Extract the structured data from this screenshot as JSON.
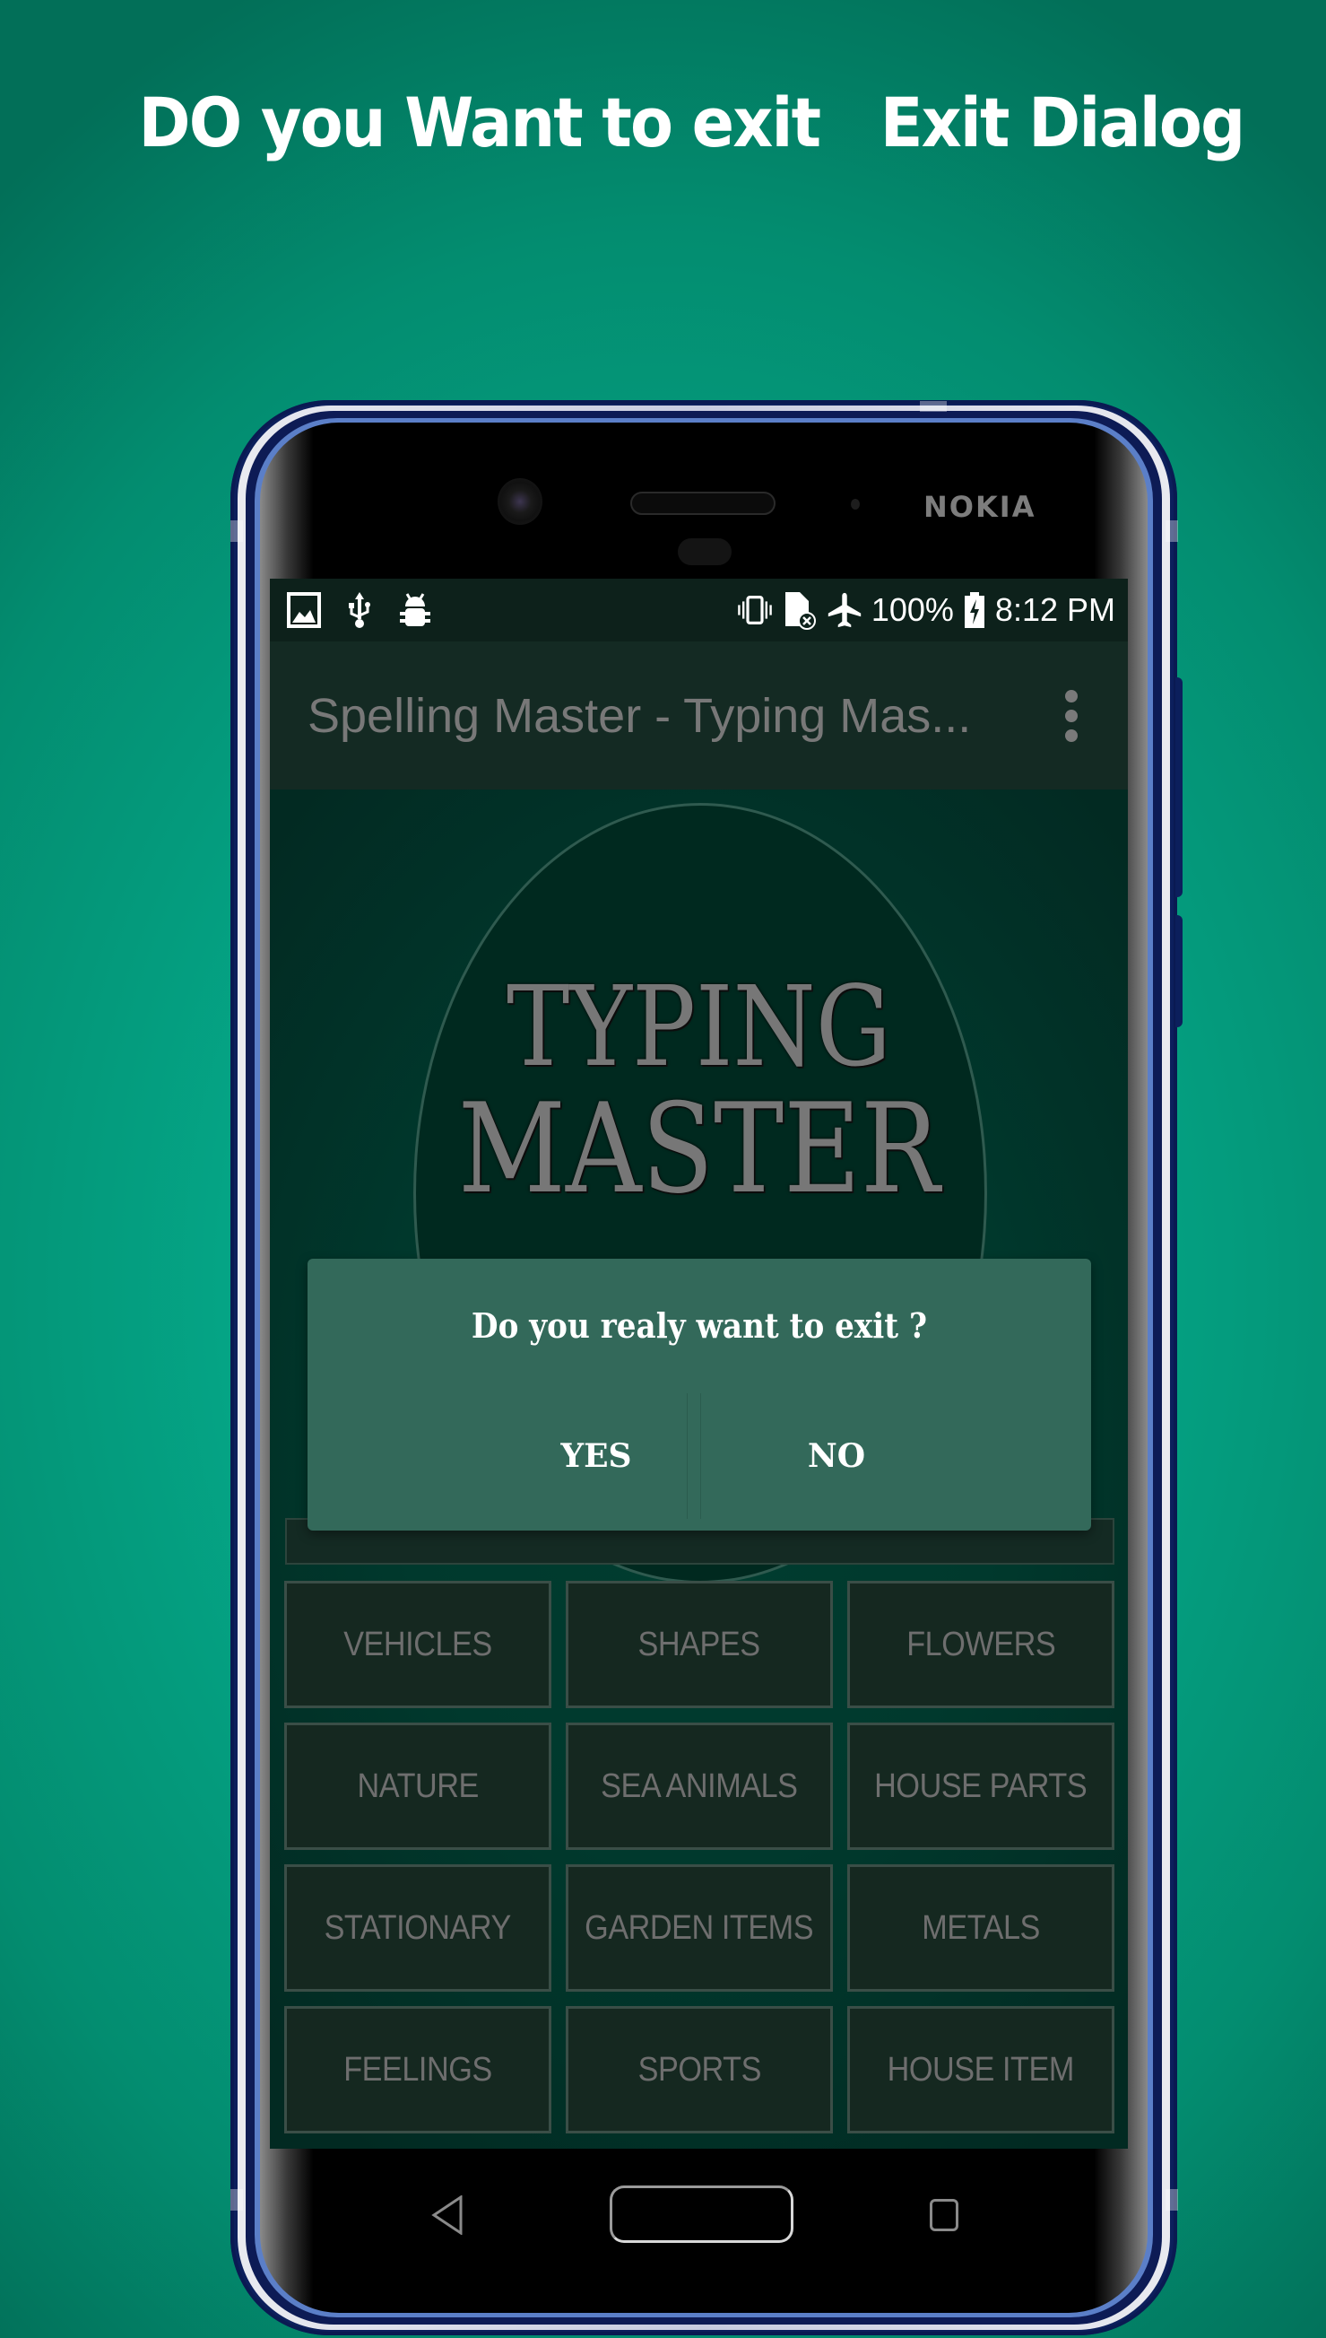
{
  "promo": {
    "title": "DO you Want to exit   Exit Dialog"
  },
  "device": {
    "brand": "NOKIA"
  },
  "status_bar": {
    "left_icons": [
      "image-icon",
      "usb-icon",
      "android-debug-icon"
    ],
    "right_icons": [
      "vibrate-icon",
      "no-sim-icon",
      "airplane-icon"
    ],
    "battery": "100%",
    "battery_icon": "battery-charging-icon",
    "time": "8:12 PM"
  },
  "app_bar": {
    "title": "Spelling Master - Typing Mas...",
    "menu_icon": "overflow-menu-icon"
  },
  "logo": {
    "line1": "TYPING",
    "line2": "MASTER"
  },
  "dialog": {
    "message": "Do you realy want to exit ?",
    "yes_label": "YES",
    "no_label": "NO"
  },
  "categories": [
    "VEHICLES",
    "SHAPES",
    "FLOWERS",
    "NATURE",
    "SEA ANIMALS",
    "HOUSE PARTS",
    "STATIONARY",
    "GARDEN ITEMS",
    "METALS",
    "FEELINGS",
    "SPORTS",
    "HOUSE ITEM"
  ],
  "nav_bar": {
    "back_icon": "back-icon",
    "home_icon": "home-icon",
    "recents_icon": "recents-icon"
  },
  "colors": {
    "background": "#05a586",
    "dialog": "#33695a",
    "app_bar": "#142a23",
    "status_bar": "#0d211b",
    "frame": "#0c1f5c"
  }
}
